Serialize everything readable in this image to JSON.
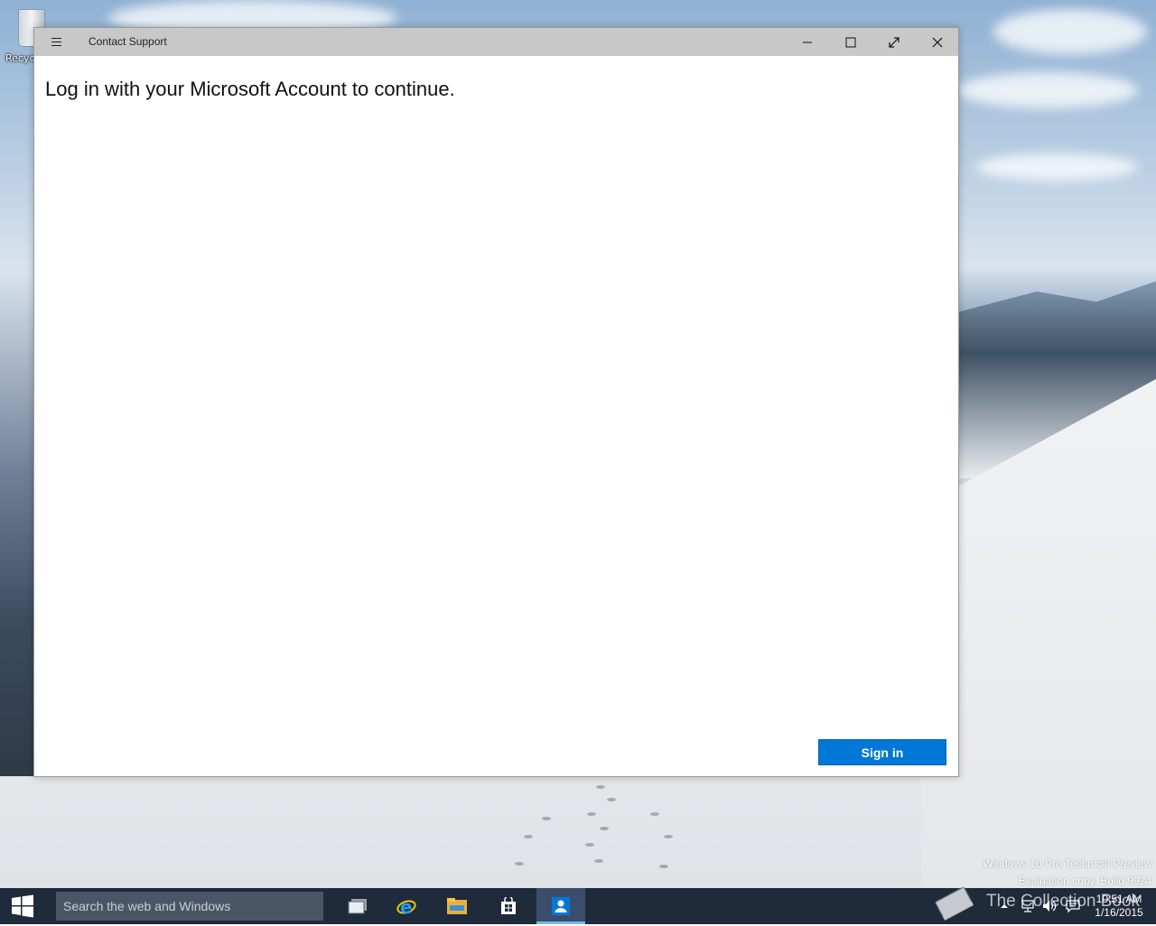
{
  "desktop": {
    "recycle_bin_label": "Recyc",
    "watermark": {
      "line1": "Windows 10 Pro Technical Preview",
      "line2": "Evaluation copy. Build 9924"
    },
    "overlay_logo_text": "The Collection Book"
  },
  "window": {
    "title": "Contact Support",
    "controls": {
      "minimize_icon": "minimize-icon",
      "maximize_icon": "maximize-icon",
      "fullscreen_icon": "fullscreen-icon",
      "close_icon": "close-icon"
    },
    "message": "Log in with your Microsoft Account to continue.",
    "sign_in_label": "Sign in"
  },
  "taskbar": {
    "search_placeholder": "Search the web and Windows",
    "pinned": [
      "task-view",
      "internet-explorer",
      "file-explorer",
      "store",
      "contact-support"
    ],
    "active_app": "contact-support",
    "clock": {
      "time": "10:51 AM",
      "date": "1/16/2015"
    }
  },
  "colors": {
    "accent": "#0078d7",
    "titlebar": "#c8c8c8",
    "taskbar": "#1f2a3a",
    "search_box": "#4a5666"
  }
}
